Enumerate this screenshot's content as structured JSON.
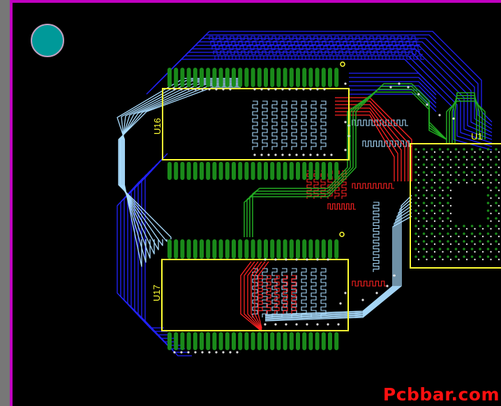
{
  "colors": {
    "board": "#000000",
    "outline": "#c000c0",
    "rail": "#777777",
    "silkscreen": "#ffff33",
    "pad": "#1a8a1a",
    "top_trace": "#ff2222",
    "bottom_trace": "#2222ff",
    "inner_trace": "#aaddff",
    "green_trace": "#22aa22",
    "via": "#dddddd",
    "mounting_hole": "#009999",
    "watermark": "#ff1010"
  },
  "components": [
    {
      "ref": "U16",
      "type": "TSOP-54 memory"
    },
    {
      "ref": "U17",
      "type": "TSOP-54 memory"
    },
    {
      "ref": "U1",
      "type": "BGA processor"
    }
  ],
  "mounting_hole": {
    "icon": "mounting-hole-icon"
  },
  "watermark": "Pcbbar.com"
}
